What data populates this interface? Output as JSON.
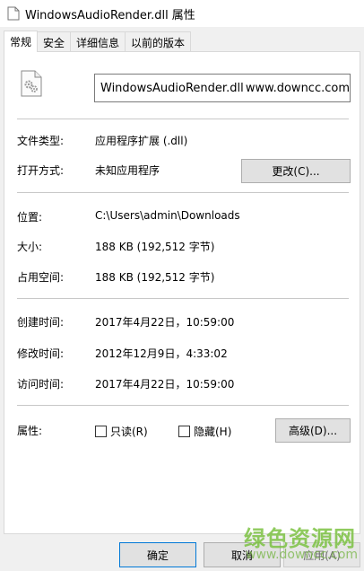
{
  "window": {
    "title": "WindowsAudioRender.dll 属性",
    "icon": "document-icon"
  },
  "tabs": [
    {
      "label": "常规",
      "active": true
    },
    {
      "label": "安全",
      "active": false
    },
    {
      "label": "详细信息",
      "active": false
    },
    {
      "label": "以前的版本",
      "active": false
    }
  ],
  "file": {
    "icon": "dll-gear-icon",
    "name": "WindowsAudioRender.dll",
    "name_suffix": "www.downcc.com"
  },
  "rows": {
    "type": {
      "label": "文件类型:",
      "value": "应用程序扩展 (.dll)"
    },
    "opens_with": {
      "label": "打开方式:",
      "value": "未知应用程序",
      "button": "更改(C)..."
    },
    "location": {
      "label": "位置:",
      "value": "C:\\Users\\admin\\Downloads"
    },
    "size": {
      "label": "大小:",
      "value": "188 KB (192,512 字节)"
    },
    "size_on_disk": {
      "label": "占用空间:",
      "value": "188 KB (192,512 字节)"
    },
    "created": {
      "label": "创建时间:",
      "value": "2017年4月22日，10:59:00"
    },
    "modified": {
      "label": "修改时间:",
      "value": "2012年12月9日，4:33:02"
    },
    "accessed": {
      "label": "访问时间:",
      "value": "2017年4月22日，10:59:00"
    },
    "attributes": {
      "label": "属性:",
      "readonly": "只读(R)",
      "hidden": "隐藏(H)",
      "advanced_button": "高级(D)..."
    }
  },
  "footer": {
    "ok": "确定",
    "cancel": "取消",
    "apply": "应用(A)"
  },
  "watermark": {
    "text": "绿色资源网",
    "url": "www.downcc.com"
  }
}
